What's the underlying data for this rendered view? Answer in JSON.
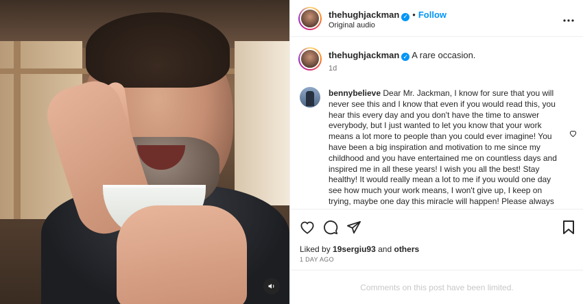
{
  "post_header": {
    "username": "thehughjackman",
    "separator": "•",
    "follow_label": "Follow",
    "audio_label": "Original audio",
    "more_label": "•••"
  },
  "caption": {
    "username": "thehughjackman",
    "text": "A rare occasion.",
    "time": "1d"
  },
  "comment": {
    "username": "bennybelieve",
    "text": "Dear Mr. Jackman, I know for sure that you will never see this and I know that even if you would read this, you hear this every day and you don't have the time to answer everybody, but I just wanted to let you know that your work means a lot more to people than you could ever imagine! You have been a big inspiration and motivation to me since my childhood and you have entertained me on countless days and inspired me in all these years! I wish you all the best! Stay healthy! It would really mean a lot to me if you would one day see how much your work means, I won't give up, I keep on trying, maybe one day this miracle will happen! Please always stay as you are and never stop making other people smile Mr."
  },
  "likes": {
    "prefix": "Liked by",
    "user": "19sergiu93",
    "conjunction": "and",
    "others": "others"
  },
  "date": "1 DAY AGO",
  "comments_limited": "Comments on this post have been limited.",
  "icons": {
    "verified": "verified-badge-icon",
    "like": "heart-icon",
    "comment": "comment-bubble-icon",
    "share": "paper-plane-icon",
    "save": "bookmark-icon",
    "audio": "speaker-icon"
  },
  "colors": {
    "accent": "#0095f6",
    "text": "#262626",
    "muted": "#737373",
    "limited": "#c7c7c7"
  }
}
